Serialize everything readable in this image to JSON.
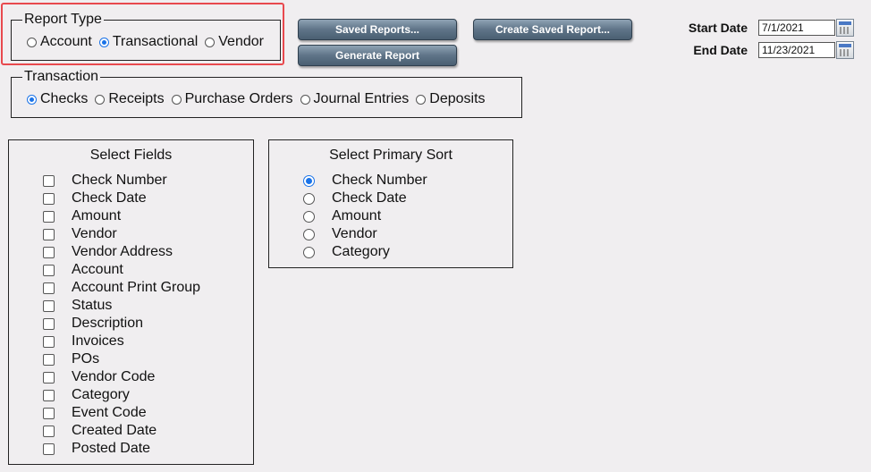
{
  "report_type": {
    "legend": "Report Type",
    "options": [
      "Account",
      "Transactional",
      "Vendor"
    ],
    "selected": "Transactional"
  },
  "buttons": {
    "saved_reports": "Saved Reports...",
    "generate_report": "Generate Report",
    "create_saved_report": "Create Saved Report..."
  },
  "dates": {
    "start_label": "Start Date",
    "start_value": "7/1/2021",
    "end_label": "End Date",
    "end_value": "11/23/2021"
  },
  "transaction": {
    "legend": "Transaction",
    "options": [
      "Checks",
      "Receipts",
      "Purchase Orders",
      "Journal Entries",
      "Deposits"
    ],
    "selected": "Checks"
  },
  "select_fields": {
    "title": "Select Fields",
    "items": [
      "Check Number",
      "Check Date",
      "Amount",
      "Vendor",
      "Vendor Address",
      "Account",
      "Account Print Group",
      "Status",
      "Description",
      "Invoices",
      "POs",
      "Vendor Code",
      "Category",
      "Event Code",
      "Created Date",
      "Posted Date"
    ]
  },
  "primary_sort": {
    "title": "Select Primary Sort",
    "items": [
      "Check Number",
      "Check Date",
      "Amount",
      "Vendor",
      "Category"
    ],
    "selected": "Check Number"
  },
  "colors": {
    "highlight": "#e8494e",
    "radio_selected": "#1a73e8",
    "button": "#5f7488"
  }
}
